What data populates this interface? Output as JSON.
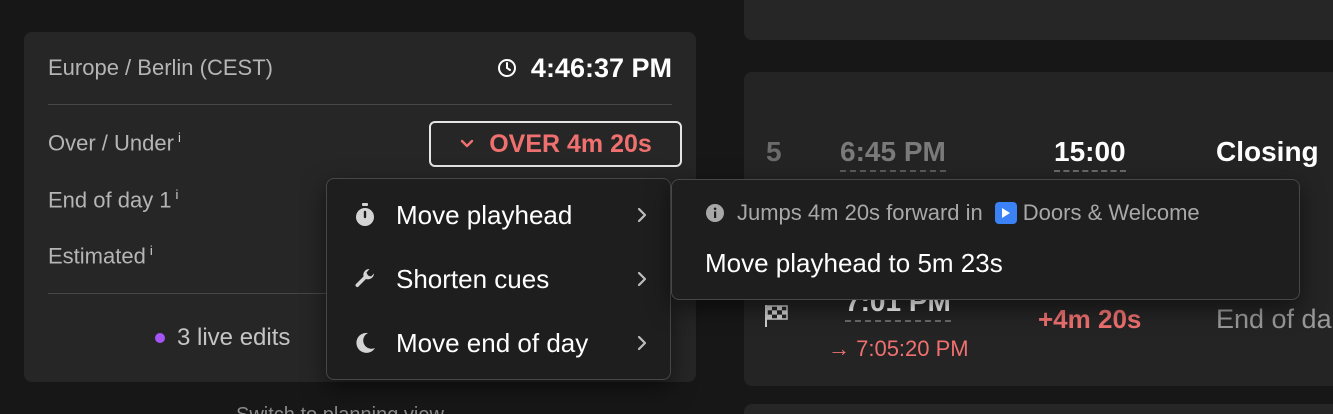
{
  "clock": {
    "timezone": "Europe / Berlin (CEST)",
    "time": "4:46:37 PM"
  },
  "rows": {
    "over_under_label": "Over / Under",
    "end_of_day_label": "End of day 1",
    "estimated_label": "Estimated",
    "info_marker": "i"
  },
  "over_badge": {
    "text": "OVER 4m 20s",
    "color": "#f07070"
  },
  "live_edits": {
    "text": "3 live edits",
    "dot_color": "#a855f7"
  },
  "cue": {
    "number": "5",
    "start": "6:45 PM",
    "duration": "15:00",
    "title": "Closing"
  },
  "end_of_day": {
    "time": "7:01 PM",
    "over": "+4m 20s",
    "label": "End of da",
    "projected": "→ 7:05:20 PM"
  },
  "cutoff_text": "Switch to planning view",
  "menu": {
    "items": [
      {
        "label": "Move playhead",
        "icon": "stopwatch-icon"
      },
      {
        "label": "Shorten cues",
        "icon": "wrench-icon"
      },
      {
        "label": "Move end of day",
        "icon": "moon-icon"
      }
    ]
  },
  "submenu": {
    "info_prefix": "Jumps 4m 20s forward in",
    "info_target": "Doors & Welcome",
    "action": "Move playhead to 5m 23s"
  },
  "colors": {
    "accent_red": "#f07070",
    "live_purple": "#a855f7",
    "play_blue": "#3b82f6"
  }
}
